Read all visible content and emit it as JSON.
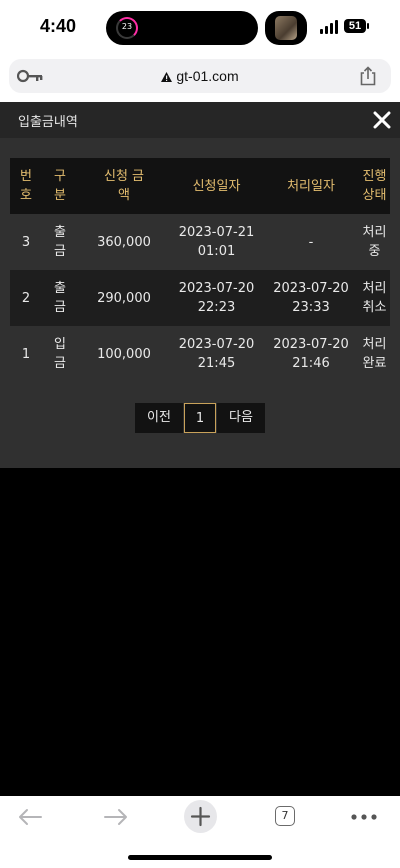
{
  "status_bar": {
    "time": "4:40",
    "activity_count": "23",
    "battery": "51"
  },
  "browser": {
    "url": "gt-01.com",
    "open_tabs": "7"
  },
  "panel": {
    "title": "입출금내역",
    "table": {
      "headers": [
        [
          "번",
          "호"
        ],
        [
          "구",
          "분"
        ],
        [
          "신청 금",
          "액"
        ],
        [
          "신청일자"
        ],
        [
          "처리일자"
        ],
        [
          "진행",
          "상태"
        ]
      ],
      "rows": [
        {
          "no": "3",
          "type": [
            "출",
            "금"
          ],
          "amount": "360,000",
          "requested": [
            "2023-07-21",
            "01:01"
          ],
          "processed": [
            "-"
          ],
          "status": [
            "처리",
            "중"
          ]
        },
        {
          "no": "2",
          "type": [
            "출",
            "금"
          ],
          "amount": "290,000",
          "requested": [
            "2023-07-20",
            "22:23"
          ],
          "processed": [
            "2023-07-20",
            "23:33"
          ],
          "status": [
            "처리",
            "취소"
          ]
        },
        {
          "no": "1",
          "type": [
            "입",
            "금"
          ],
          "amount": "100,000",
          "requested": [
            "2023-07-20",
            "21:45"
          ],
          "processed": [
            "2023-07-20",
            "21:46"
          ],
          "status": [
            "처리",
            "완료"
          ]
        }
      ]
    },
    "pagination": {
      "prev": "이전",
      "current": "1",
      "next": "다음"
    }
  },
  "colors": {
    "header_text": "#e3bd6f",
    "panel_bg": "#303030",
    "page_border": "#c9a25a",
    "activity_ring": "#ff2ea6"
  },
  "icons": [
    "key-icon",
    "warning-icon",
    "share-icon",
    "close-icon",
    "back-arrow-icon",
    "forward-arrow-icon",
    "plus-icon",
    "more-icon"
  ]
}
